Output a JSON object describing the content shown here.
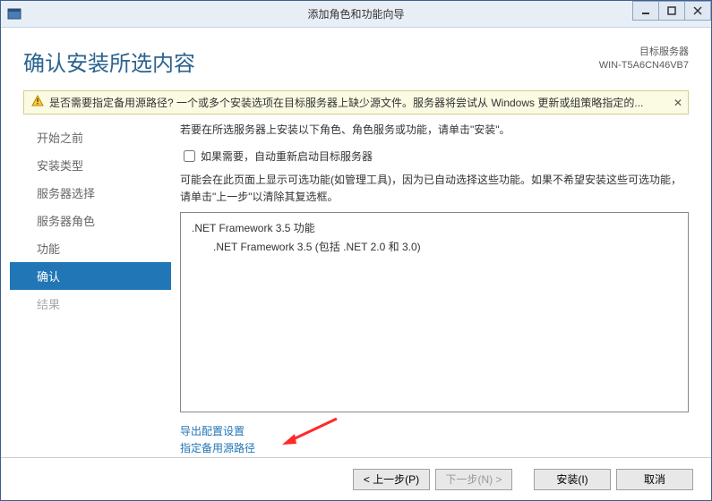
{
  "window": {
    "title": "添加角色和功能向导"
  },
  "header": {
    "heading": "确认安装所选内容",
    "target_label": "目标服务器",
    "target_value": "WIN-T5A6CN46VB7"
  },
  "warning": {
    "text": "是否需要指定备用源路径? 一个或多个安装选项在目标服务器上缺少源文件。服务器将尝试从 Windows 更新或组策略指定的..."
  },
  "sidebar": {
    "items": [
      {
        "label": "开始之前"
      },
      {
        "label": "安装类型"
      },
      {
        "label": "服务器选择"
      },
      {
        "label": "服务器角色"
      },
      {
        "label": "功能"
      },
      {
        "label": "确认"
      },
      {
        "label": "结果"
      }
    ]
  },
  "main": {
    "line1": "若要在所选服务器上安装以下角色、角色服务或功能，请单击\"安装\"。",
    "checkbox_label": "如果需要，自动重新启动目标服务器",
    "line2": "可能会在此页面上显示可选功能(如管理工具)，因为已自动选择这些功能。如果不希望安装这些可选功能，请单击\"上一步\"以清除其复选框。",
    "features": {
      "parent": ".NET Framework 3.5 功能",
      "child": ".NET Framework 3.5 (包括 .NET 2.0 和 3.0)"
    },
    "link_export": "导出配置设置",
    "link_path": "指定备用源路径"
  },
  "footer": {
    "prev": "< 上一步(P)",
    "next": "下一步(N) >",
    "install": "安装(I)",
    "cancel": "取消"
  }
}
